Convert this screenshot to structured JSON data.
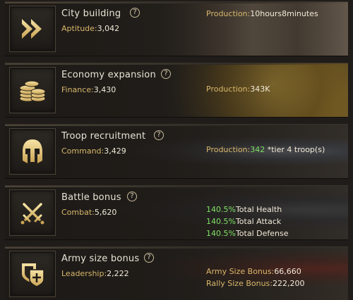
{
  "cards": [
    {
      "title": "City building",
      "stat_label": "Aptitude:",
      "stat_value": "3,042",
      "production_label": "Production:",
      "production_value": "10hours8minutes",
      "icon": "fast-forward-icon"
    },
    {
      "title": "Economy expansion",
      "stat_label": "Finance:",
      "stat_value": "3,430",
      "production_label": "Production:",
      "production_value": "343K",
      "icon": "gold-coins-icon"
    },
    {
      "title": "Troop recruitment",
      "stat_label": "Command:",
      "stat_value": "3,429",
      "production_label": "Production:",
      "production_value": "342",
      "production_suffix": " *tier 4 troop(s)",
      "icon": "spartan-helmet-icon"
    },
    {
      "title": "Battle bonus",
      "stat_label": "Combat:",
      "stat_value": "5,620",
      "bonuses": [
        {
          "value": "140.5%",
          "label": "Total Health"
        },
        {
          "value": "140.5%",
          "label": "Total Attack"
        },
        {
          "value": "140.5%",
          "label": "Total Defense"
        }
      ],
      "icon": "crossed-swords-icon"
    },
    {
      "title": "Army size bonus",
      "stat_label": "Leadership:",
      "stat_value": "2,222",
      "army_size_label": "Army Size Bonus:",
      "army_size_value": "66,660",
      "rally_size_label": "Rally Size Bonus:",
      "rally_size_value": "222,200",
      "icon": "shield-banner-icon"
    }
  ],
  "help_glyph": "?",
  "colors": {
    "gold": "#d9b76b",
    "green": "#7fe066",
    "title": "#e9e4d6"
  }
}
